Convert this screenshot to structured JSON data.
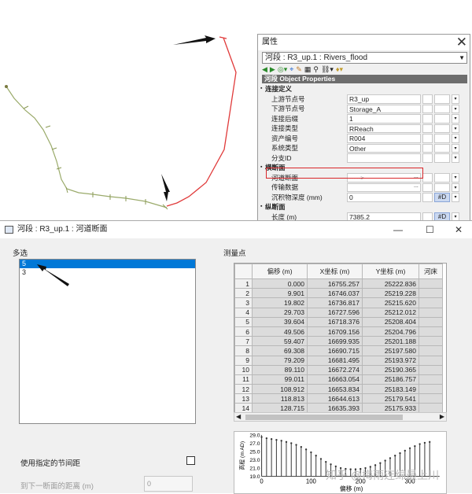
{
  "props_panel": {
    "title": "属性",
    "selector": "河段 : R3_up.1 : Rivers_flood",
    "header": "河段 Object Properties",
    "rows": [
      {
        "type": "section",
        "label": "连接定义"
      },
      {
        "type": "field",
        "label": "上游节点号",
        "value": "R3_up"
      },
      {
        "type": "field",
        "label": "下游节点号",
        "value": "Storage_A"
      },
      {
        "type": "field",
        "label": "连接后缀",
        "value": "1"
      },
      {
        "type": "field",
        "label": "连接类型",
        "value": "RReach"
      },
      {
        "type": "field",
        "label": "资产编号",
        "value": "R004"
      },
      {
        "type": "field",
        "label": "系统类型",
        "value": "Other"
      },
      {
        "type": "field",
        "label": "分支ID",
        "value": ""
      },
      {
        "type": "section",
        "label": "横断面"
      },
      {
        "type": "field",
        "label": "河道断面",
        "value": "----->"
      },
      {
        "type": "field",
        "label": "传输数据",
        "value": ""
      },
      {
        "type": "field",
        "label": "沉积物深度 (mm)",
        "value": "0",
        "flag": "#D"
      },
      {
        "type": "section",
        "label": "纵断面"
      },
      {
        "type": "field",
        "label": "长度 (m)",
        "value": "7385.2",
        "flag": "#D"
      }
    ]
  },
  "dialog": {
    "title": "河段 : R3_up.1 : 河道断面",
    "multi_select_label": "多选",
    "list_items": [
      "5",
      "3"
    ],
    "selected_index": 0,
    "use_spacing_label": "使用指定的节间距",
    "next_distance_label": "到下一断面的距离 (m)",
    "next_distance_value": "0",
    "survey_points_label": "测量点",
    "columns": [
      "偏移 (m)",
      "X坐标 (m)",
      "Y坐标 (m)",
      "河床"
    ],
    "rows": [
      [
        "1",
        "0.000",
        "16755.257",
        "25222.836"
      ],
      [
        "2",
        "9.901",
        "16746.037",
        "25219.228"
      ],
      [
        "3",
        "19.802",
        "16736.817",
        "25215.620"
      ],
      [
        "4",
        "29.703",
        "16727.596",
        "25212.012"
      ],
      [
        "5",
        "39.604",
        "16718.376",
        "25208.404"
      ],
      [
        "6",
        "49.506",
        "16709.156",
        "25204.796"
      ],
      [
        "7",
        "59.407",
        "16699.935",
        "25201.188"
      ],
      [
        "8",
        "69.308",
        "16690.715",
        "25197.580"
      ],
      [
        "9",
        "79.209",
        "16681.495",
        "25193.972"
      ],
      [
        "10",
        "89.110",
        "16672.274",
        "25190.365"
      ],
      [
        "11",
        "99.011",
        "16663.054",
        "25186.757"
      ],
      [
        "12",
        "108.912",
        "16653.834",
        "25183.149"
      ],
      [
        "13",
        "118.813",
        "16644.613",
        "25179.541"
      ],
      [
        "14",
        "128.715",
        "16635.393",
        "25175.933"
      ]
    ]
  },
  "chart_data": {
    "type": "bar",
    "xlabel": "偏移 (m)",
    "ylabel": "高程 (m AD)",
    "ylim": [
      19.0,
      29.0
    ],
    "yticks": [
      "29.0",
      "27.0",
      "25.0",
      "23.0",
      "21.0",
      "19.0"
    ],
    "xticks": [
      "0",
      "100",
      "200",
      "300"
    ],
    "x": [
      0,
      10,
      20,
      30,
      40,
      50,
      60,
      70,
      80,
      90,
      100,
      110,
      120,
      130,
      140,
      150,
      160,
      170,
      180,
      190,
      200,
      210,
      220,
      230,
      240,
      250,
      260,
      270,
      280,
      290,
      300,
      310,
      320,
      330,
      340
    ],
    "values": [
      28.5,
      28.2,
      28.0,
      27.8,
      27.6,
      27.3,
      27.0,
      26.6,
      26.1,
      25.5,
      24.8,
      24.0,
      23.2,
      22.5,
      21.9,
      21.4,
      21.0,
      20.8,
      20.7,
      20.7,
      20.8,
      21.0,
      21.3,
      21.7,
      22.2,
      22.8,
      23.4,
      24.0,
      24.6,
      25.2,
      25.8,
      26.3,
      26.8,
      27.1,
      27.3
    ]
  },
  "watermark": "知乎 @梅雨连绵最上川"
}
